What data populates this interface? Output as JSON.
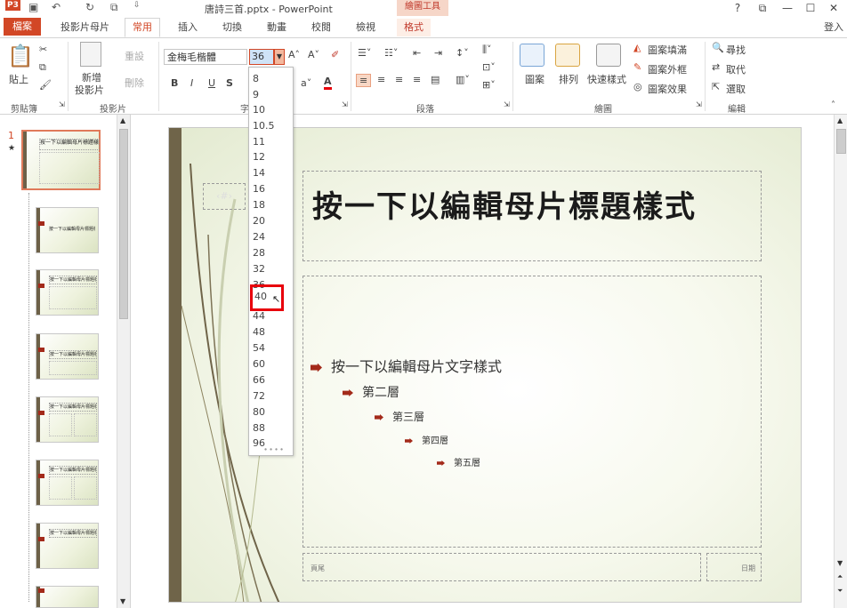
{
  "titlebar": {
    "app_icon": "P3",
    "title": "唐詩三首.pptx - PowerPoint",
    "context_title": "繪圖工具",
    "help": "?",
    "restore": "⧉",
    "minimize": "—",
    "maximize": "☐",
    "close": "✕"
  },
  "tabs": {
    "file": "檔案",
    "items": [
      "投影片母片",
      "常用",
      "插入",
      "切換",
      "動畫",
      "校閱",
      "檢視",
      "格式"
    ],
    "login": "登入"
  },
  "ribbon": {
    "clipboard": {
      "paste": "貼上",
      "label": "剪貼簿"
    },
    "slides": {
      "new_slide": "新增",
      "new_slide2": "投影片",
      "reset": "重設",
      "delete": "刪除",
      "label": "投影片"
    },
    "font": {
      "name": "金梅毛楷體",
      "size": "36",
      "bold": "B",
      "italic": "I",
      "underline": "U",
      "shadow": "S",
      "label": "字型"
    },
    "paragraph": {
      "label": "段落"
    },
    "drawing": {
      "shapes": "圖案",
      "arrange": "排列",
      "quick_styles": "快速樣式",
      "fill": "圖案填滿",
      "outline": "圖案外框",
      "effects": "圖案效果",
      "label": "繪圖"
    },
    "editing": {
      "find": "尋找",
      "replace": "取代",
      "select": "選取",
      "label": "編輯"
    }
  },
  "font_sizes": [
    "8",
    "9",
    "10",
    "10.5",
    "11",
    "12",
    "14",
    "16",
    "18",
    "20",
    "24",
    "28",
    "32",
    "36",
    "40",
    "44",
    "48",
    "54",
    "60",
    "66",
    "72",
    "80",
    "88",
    "96"
  ],
  "font_sizes_highlighted": "40",
  "thumbnails": {
    "selected_number": "1",
    "selected_mark": "★",
    "title_text": "按一下以編輯母片標題樣式"
  },
  "slide": {
    "title": "按一下以編輯母片標題樣式",
    "level1": "按一下以編輯母片文字樣式",
    "level2": "第二層",
    "level3": "第三層",
    "level4": "第四層",
    "level5": "第五層",
    "footer": "頁尾",
    "date": "日期",
    "slide_number": "‹#›"
  },
  "colors": {
    "accent": "#d24726",
    "highlight": "#e8000b",
    "bullet": "#a32a1a"
  }
}
